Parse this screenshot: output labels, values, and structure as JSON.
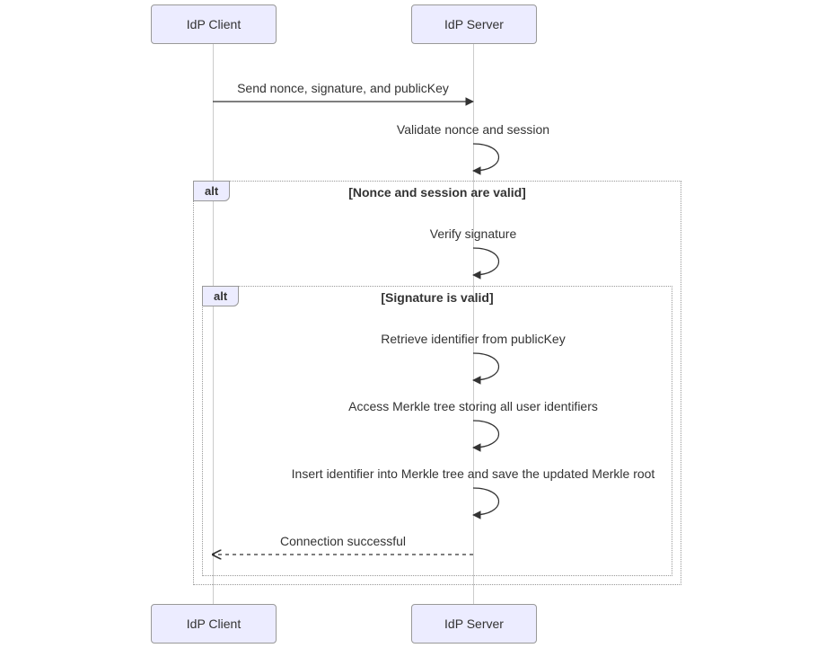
{
  "diagram": {
    "type": "sequence",
    "participants": {
      "client": "IdP Client",
      "server": "IdP Server"
    },
    "messages": {
      "m1": "Send nonce, signature, and publicKey",
      "m2": "Validate nonce and session",
      "m3": "Verify signature",
      "m4": "Retrieve identifier from publicKey",
      "m5": "Access Merkle tree storing all user identifiers",
      "m6": "Insert identifier into Merkle tree and save the updated Merkle root",
      "m7": "Connection successful"
    },
    "alt": {
      "outer": {
        "tag": "alt",
        "guard": "[Nonce and session are valid]"
      },
      "inner": {
        "tag": "alt",
        "guard": "[Signature is valid]"
      }
    }
  }
}
